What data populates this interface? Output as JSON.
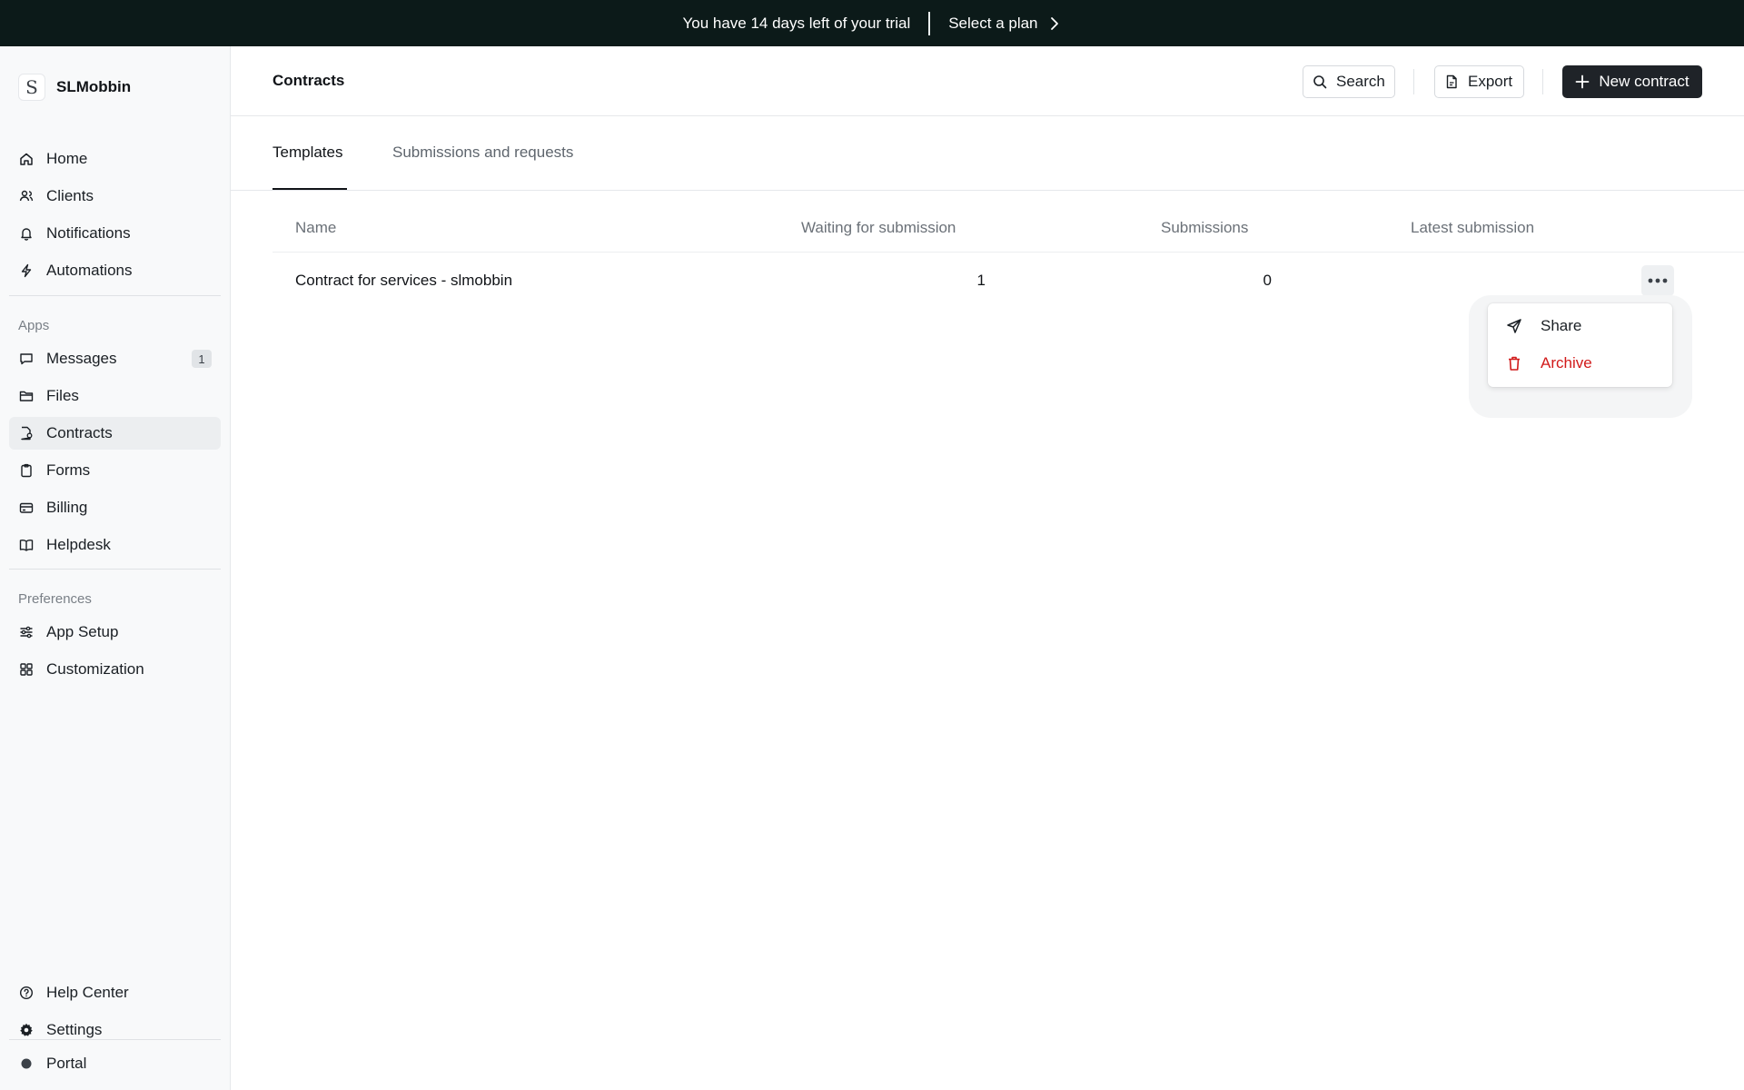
{
  "banner": {
    "trial_text": "You have 14 days left of your trial",
    "plan_link": "Select a plan"
  },
  "sidebar": {
    "brand": {
      "logo_letter": "S",
      "name": "SLMobbin"
    },
    "main_items": [
      {
        "label": "Home",
        "icon": "home-icon"
      },
      {
        "label": "Clients",
        "icon": "users-icon"
      },
      {
        "label": "Notifications",
        "icon": "bell-icon"
      },
      {
        "label": "Automations",
        "icon": "lightning-icon"
      }
    ],
    "apps_label": "Apps",
    "app_items": [
      {
        "label": "Messages",
        "icon": "message-icon",
        "badge": "1"
      },
      {
        "label": "Files",
        "icon": "folder-icon"
      },
      {
        "label": "Contracts",
        "icon": "contract-icon",
        "active": true
      },
      {
        "label": "Forms",
        "icon": "clipboard-icon"
      },
      {
        "label": "Billing",
        "icon": "credit-card-icon"
      },
      {
        "label": "Helpdesk",
        "icon": "book-icon"
      }
    ],
    "preferences_label": "Preferences",
    "preference_items": [
      {
        "label": "App Setup",
        "icon": "sliders-icon"
      },
      {
        "label": "Customization",
        "icon": "grid-icon"
      }
    ],
    "bottom_items": [
      {
        "label": "Help Center",
        "icon": "help-circle-icon"
      },
      {
        "label": "Settings",
        "icon": "gear-icon"
      }
    ],
    "portal": {
      "label": "Portal",
      "icon": "dot-icon"
    }
  },
  "header": {
    "title": "Contracts",
    "search_label": "Search",
    "export_label": "Export",
    "new_contract_label": "New contract"
  },
  "tabs": [
    {
      "label": "Templates",
      "active": true
    },
    {
      "label": "Submissions and requests",
      "active": false
    }
  ],
  "table": {
    "columns": [
      "Name",
      "Waiting for submission",
      "Submissions",
      "Latest submission"
    ],
    "rows": [
      {
        "name": "Contract for services - slmobbin",
        "waiting": "1",
        "submissions": "0",
        "latest": ""
      }
    ]
  },
  "row_menu": {
    "share_label": "Share",
    "archive_label": "Archive"
  },
  "colors": {
    "banner_bg": "#0c1a19",
    "primary_button": "#1f2328",
    "danger": "#d11a1a",
    "sidebar_bg": "#f8f9fa"
  }
}
